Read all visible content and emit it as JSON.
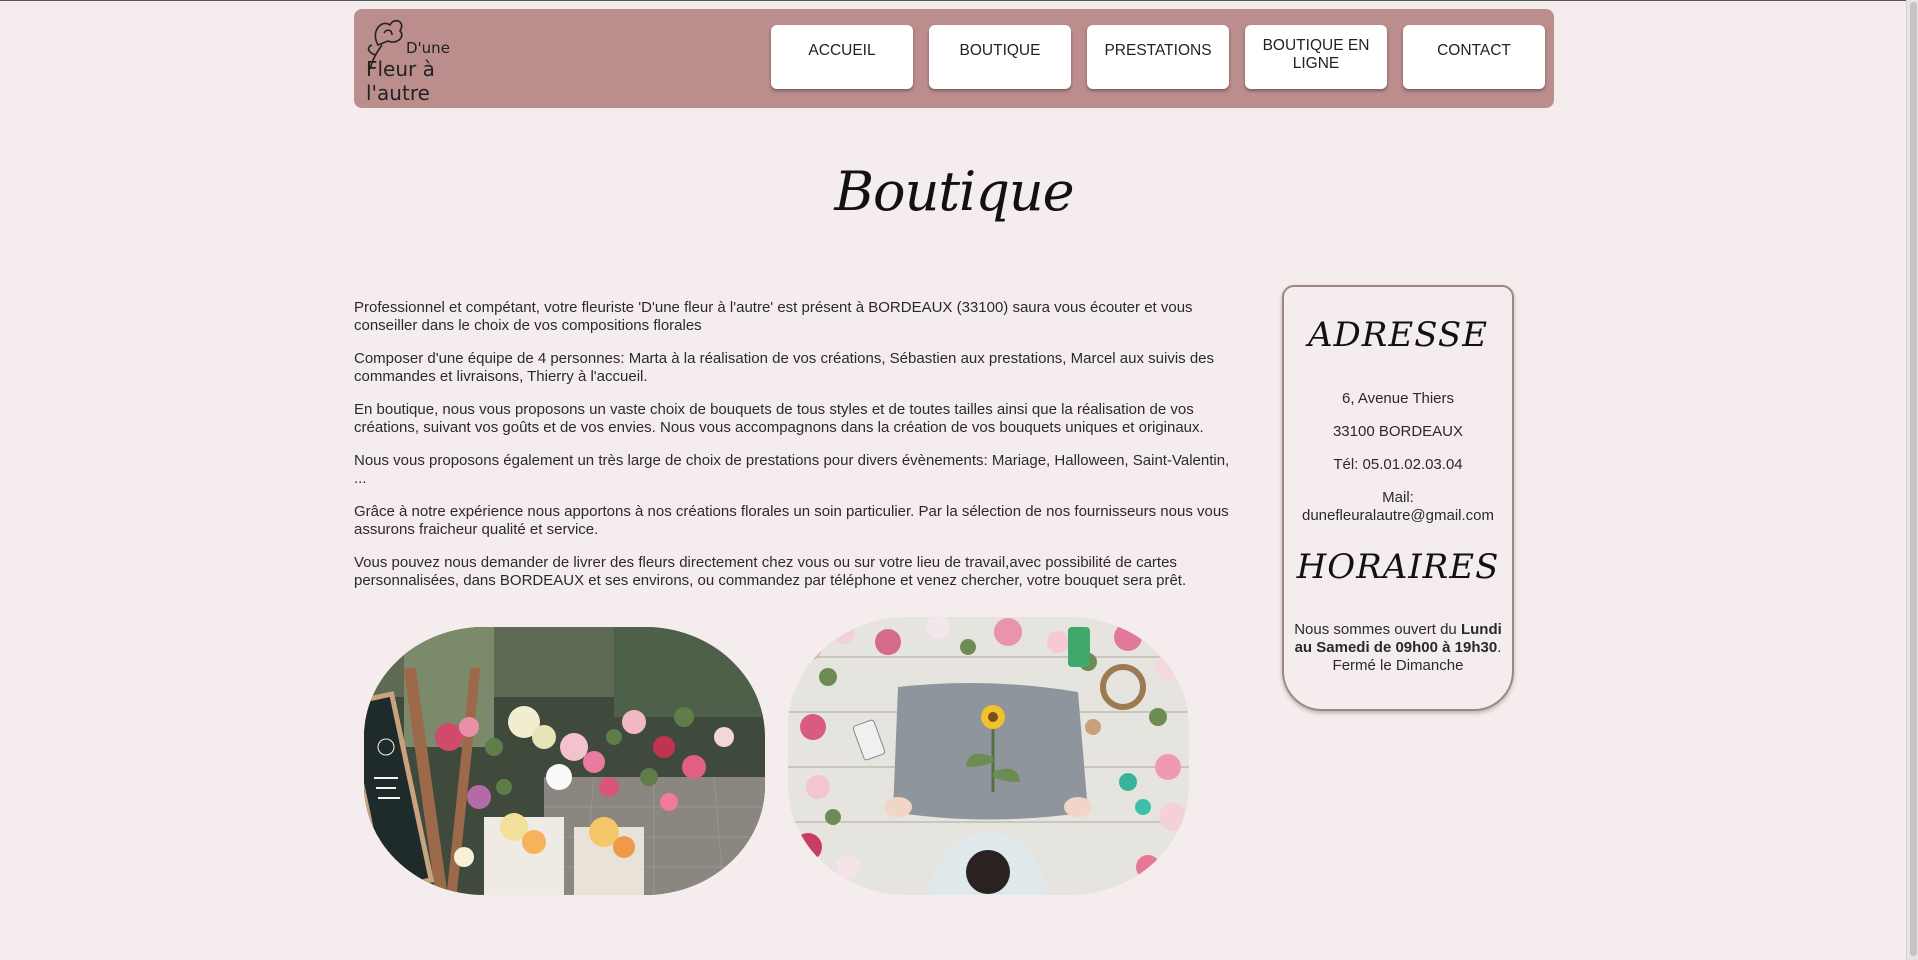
{
  "header": {
    "logo": {
      "line1": "D'une",
      "line2": "Fleur à",
      "line3": "l'autre"
    },
    "nav": [
      "ACCUEIL",
      "BOUTIQUE",
      "PRESTATIONS",
      "BOUTIQUE EN LIGNE",
      "CONTACT"
    ]
  },
  "page_title": "Boutique",
  "content": {
    "paragraphs": [
      "Professionnel et compétant, votre fleuriste 'D'une fleur à l'autre' est présent à BORDEAUX (33100) saura vous écouter et vous conseiller dans le choix de vos compositions florales",
      "Composer d'une équipe de 4 personnes: Marta à la réalisation de vos créations, Sébastien aux prestations, Marcel aux suivis des commandes et livraisons, Thierry à l'accueil.",
      "En boutique, nous vous proposons un vaste choix de bouquets de tous styles et de toutes tailles ainsi que la réalisation de vos créations, suivant vos goûts et de vos envies. Nous vous accompagnons dans la création de vos bouquets uniques et originaux.",
      "Nous vous proposons également un très large de choix de prestations pour divers évènements: Mariage, Halloween, Saint-Valentin, ...",
      "Grâce à notre expérience nous apportons à nos créations florales un soin particulier. Par la sélection de nos fournisseurs nous vous assurons fraicheur qualité et service.",
      "Vous pouvez nous demander de livrer des fleurs directement chez vous ou sur votre lieu de travail,avec possibilité de cartes personnalisées, dans BORDEAUX et ses environs, ou commandez par téléphone et venez chercher, votre bouquet sera prêt."
    ]
  },
  "info_card": {
    "address_heading": "ADRESSE",
    "street": "6, Avenue Thiers",
    "city": "33100 BORDEAUX",
    "phone": "Tél: 05.01.02.03.04",
    "mail_label": "Mail:",
    "mail": "dunefleuralautre@gmail.com",
    "hours_heading": "HORAIRES",
    "hours_prefix": "Nous sommes ouvert du ",
    "hours_bold": "Lundi au Samedi de 09h00 à 19h30",
    "hours_suffix": ".",
    "closed": "Fermé le Dimanche"
  },
  "colors": {
    "background": "#f5eded",
    "header": "#bc8d8d",
    "card_border": "#a08585"
  }
}
